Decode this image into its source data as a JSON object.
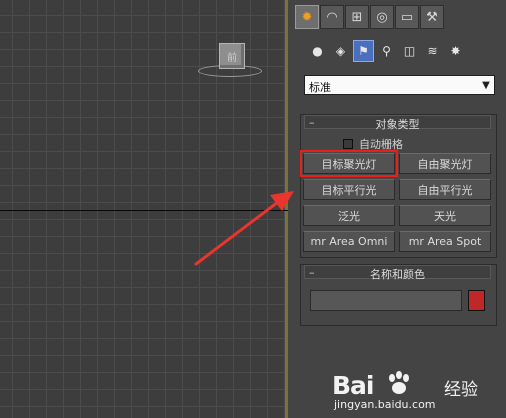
{
  "viewport": {
    "viewcube_label": "前"
  },
  "command_panel": {
    "tabs": [
      {
        "name": "create",
        "icon": "✹",
        "active": true
      },
      {
        "name": "modify",
        "icon": "◠"
      },
      {
        "name": "hierarchy",
        "icon": "⊞"
      },
      {
        "name": "motion",
        "icon": "◎"
      },
      {
        "name": "display",
        "icon": "▭"
      },
      {
        "name": "utilities",
        "icon": "⚒"
      }
    ],
    "object_types": [
      {
        "name": "geometry",
        "icon": "●"
      },
      {
        "name": "shapes",
        "icon": "◈"
      },
      {
        "name": "lights",
        "icon": "⚑",
        "active": true
      },
      {
        "name": "cameras",
        "icon": "⚲"
      },
      {
        "name": "helpers",
        "icon": "◫"
      },
      {
        "name": "space-warps",
        "icon": "≋"
      },
      {
        "name": "systems",
        "icon": "✸"
      }
    ],
    "category_dropdown": "标准",
    "object_type_rollout": {
      "title": "对象类型",
      "autogrid_label": "自动栅格",
      "buttons": [
        "目标聚光灯",
        "自由聚光灯",
        "目标平行光",
        "自由平行光",
        "泛光",
        "天光",
        "mr Area Omni",
        "mr Area Spot"
      ],
      "highlighted": "目标聚光灯"
    },
    "name_color_rollout": {
      "title": "名称和颜色",
      "color": "#c02828"
    }
  },
  "watermark": {
    "logo": "Bai",
    "site": "经验",
    "url": "jingyan.baidu.com"
  }
}
